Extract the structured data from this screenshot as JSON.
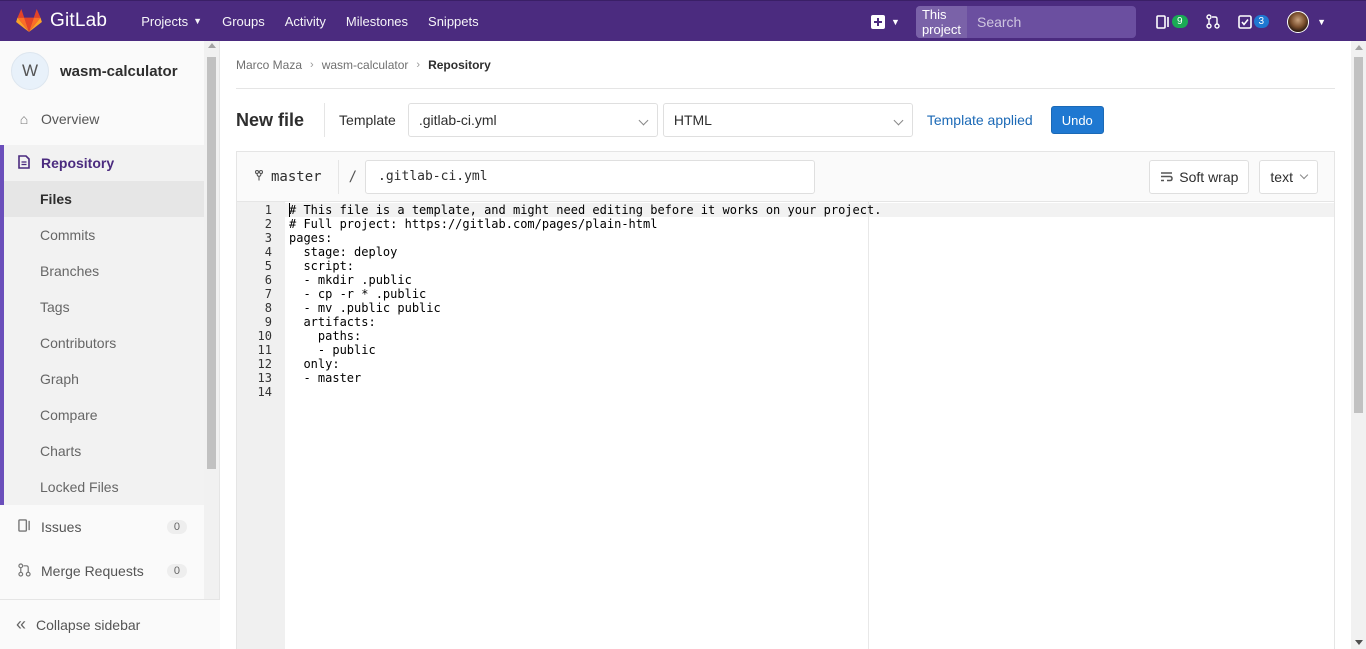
{
  "topnav": {
    "brand": "GitLab",
    "links": [
      "Projects",
      "Groups",
      "Activity",
      "Milestones",
      "Snippets"
    ],
    "search_scope": "This project",
    "search_placeholder": "Search",
    "issues_badge": "9",
    "todos_badge": "3",
    "accent": "#4b2b7f"
  },
  "sidebar": {
    "project_initial": "W",
    "project_name": "wasm-calculator",
    "overview": "Overview",
    "repository": "Repository",
    "repo_items": [
      "Files",
      "Commits",
      "Branches",
      "Tags",
      "Contributors",
      "Graph",
      "Compare",
      "Charts",
      "Locked Files"
    ],
    "issues": {
      "label": "Issues",
      "count": "0"
    },
    "merge_requests": {
      "label": "Merge Requests",
      "count": "0"
    },
    "collapse": "Collapse sidebar"
  },
  "breadcrumb": {
    "items": [
      "Marco Maza",
      "wasm-calculator"
    ],
    "current": "Repository"
  },
  "editor": {
    "title": "New file",
    "template_label": "Template",
    "template_value": ".gitlab-ci.yml",
    "type_value": "HTML",
    "template_applied": "Template applied",
    "undo": "Undo",
    "branch": "master",
    "slash": "/",
    "filename": ".gitlab-ci.yml",
    "soft_wrap": "Soft wrap",
    "language": "text",
    "lines": [
      "# This file is a template, and might need editing before it works on your project.",
      "# Full project: https://gitlab.com/pages/plain-html",
      "pages:",
      "  stage: deploy",
      "  script:",
      "  - mkdir .public",
      "  - cp -r * .public",
      "  - mv .public public",
      "  artifacts:",
      "    paths:",
      "    - public",
      "  only:",
      "  - master",
      ""
    ]
  }
}
